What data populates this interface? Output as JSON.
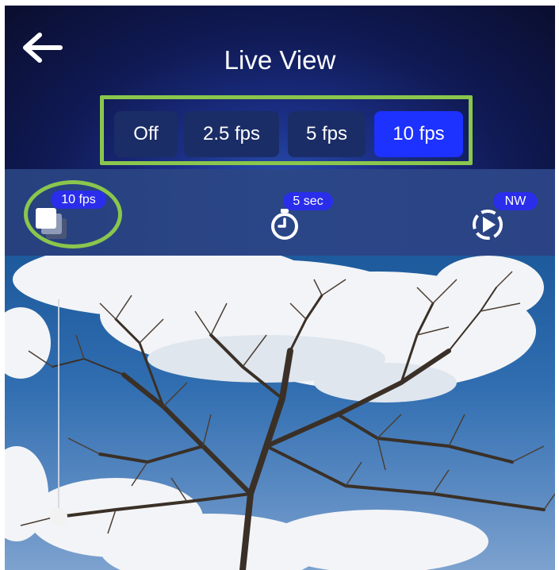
{
  "header": {
    "title": "Live View",
    "back_icon": "arrow-left-icon"
  },
  "fps_options": [
    {
      "label": "Off",
      "selected": false
    },
    {
      "label": "2.5 fps",
      "selected": false
    },
    {
      "label": "5 fps",
      "selected": false
    },
    {
      "label": "10 fps",
      "selected": true
    }
  ],
  "toolbar": {
    "burst": {
      "icon": "burst-frames-icon",
      "badge": "10 fps"
    },
    "timer": {
      "icon": "stopwatch-icon",
      "badge": "5 sec"
    },
    "direction": {
      "icon": "compass-direction-icon",
      "badge": "NW"
    }
  },
  "colors": {
    "highlight": "#8ac64d",
    "selected_button": "#1d31ff",
    "button": "#1a2d66",
    "badge": "#2a2eea"
  }
}
